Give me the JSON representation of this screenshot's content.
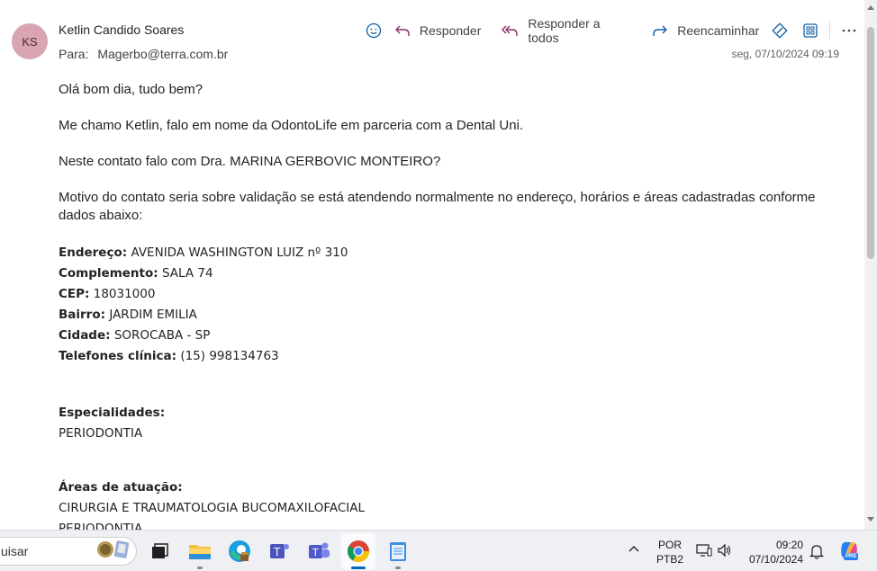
{
  "email": {
    "avatar_initials": "KS",
    "avatar_color": "#d9a5b3",
    "sender": "Ketlin Candido Soares",
    "to_label": "Para:",
    "to_address": "Magerbo@terra.com.br",
    "datetime": "seg, 07/10/2024 09:19",
    "actions": {
      "reply": "Responder",
      "reply_all": "Responder a todos",
      "forward": "Reencaminhar"
    },
    "greeting": "Olá bom dia, tudo bem?",
    "intro": "Me chamo Ketlin, falo em nome da OdontoLife em parceria com a Dental Uni.",
    "question": "Neste contato falo com Dra. MARINA GERBOVIC MONTEIRO?",
    "reason": "Motivo do contato seria sobre validação se está atendendo normalmente no endereço, horários e áreas cadastradas conforme dados abaixo:",
    "fields": [
      {
        "label": "Endereço:",
        "value": "AVENIDA WASHINGTON LUIZ nº 310"
      },
      {
        "label": "Complemento:",
        "value": "SALA 74"
      },
      {
        "label": "CEP:",
        "value": "18031000"
      },
      {
        "label": "Bairro:",
        "value": "JARDIM EMILIA"
      },
      {
        "label": "Cidade:",
        "value": "SOROCABA - SP"
      },
      {
        "label": "Telefones clínica:",
        "value": "(15) 998134763"
      }
    ],
    "specialties_title": "Especialidades:",
    "specialties": [
      "PERIODONTIA"
    ],
    "areas_title": "Áreas de atuação:",
    "areas": [
      "CIRURGIA E TRAUMATOLOGIA BUCOMAXILOFACIAL",
      "PERIODONTIA"
    ]
  },
  "taskbar": {
    "search_text": "uisar",
    "lang_line1": "POR",
    "lang_line2": "PTB2",
    "time": "09:20",
    "date": "07/10/2024",
    "copilot_badge": "PRE",
    "accent_color": "#0067c0"
  }
}
